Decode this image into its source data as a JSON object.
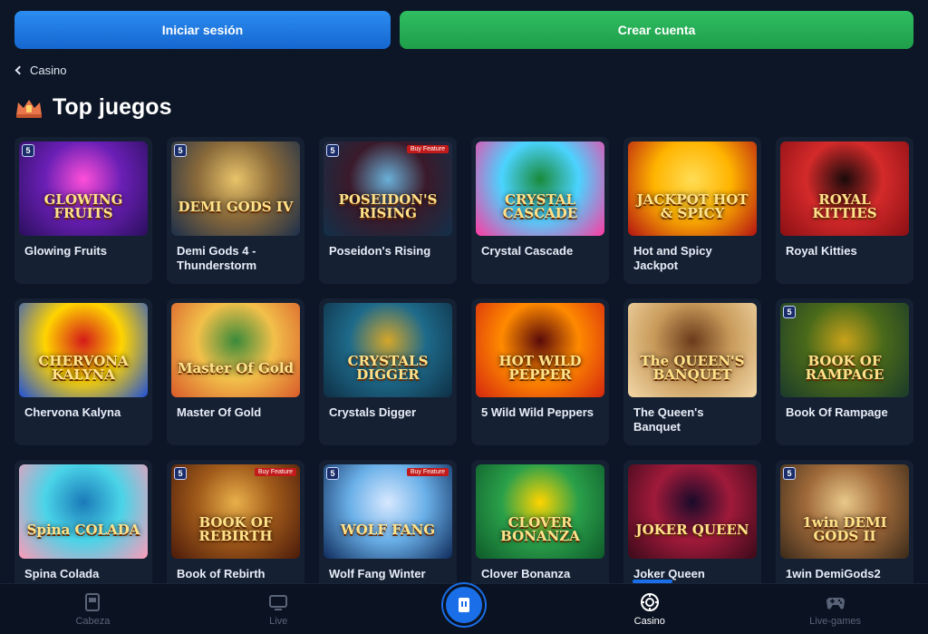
{
  "auth": {
    "login_label": "Iniciar sesión",
    "signup_label": "Crear cuenta"
  },
  "breadcrumb": {
    "label": "Casino"
  },
  "section": {
    "title": "Top juegos"
  },
  "games": [
    {
      "name": "Glowing Fruits",
      "art": "GLOWING FRUITS",
      "provider": "5",
      "tag": ""
    },
    {
      "name": "Demi Gods 4 - Thunderstorm",
      "art": "DEMI GODS IV",
      "provider": "5",
      "tag": ""
    },
    {
      "name": "Poseidon's Rising",
      "art": "POSEIDON'S RISING",
      "provider": "5",
      "tag": "Buy Feature"
    },
    {
      "name": "Crystal Cascade",
      "art": "CRYSTAL CASCADE",
      "provider": "",
      "tag": ""
    },
    {
      "name": "Hot and Spicy Jackpot",
      "art": "JACKPOT HOT & SPICY",
      "provider": "",
      "tag": ""
    },
    {
      "name": "Royal Kitties",
      "art": "ROYAL KITTIES",
      "provider": "",
      "tag": ""
    },
    {
      "name": "Chervona Kalyna",
      "art": "CHERVONA KALYNA",
      "provider": "",
      "tag": ""
    },
    {
      "name": "Master Of Gold",
      "art": "Master Of Gold",
      "provider": "",
      "tag": ""
    },
    {
      "name": "Crystals Digger",
      "art": "CRYSTALS DIGGER",
      "provider": "",
      "tag": ""
    },
    {
      "name": "5 Wild Wild Peppers",
      "art": "HOT WILD PEPPER",
      "provider": "",
      "tag": ""
    },
    {
      "name": "The Queen's Banquet",
      "art": "The QUEEN'S BANQUET",
      "provider": "",
      "tag": ""
    },
    {
      "name": "Book Of Rampage",
      "art": "BOOK OF RAMPAGE",
      "provider": "5",
      "tag": ""
    },
    {
      "name": "Spina Colada",
      "art": "Spina COLADA",
      "provider": "",
      "tag": ""
    },
    {
      "name": "Book of Rebirth",
      "art": "BOOK OF REBIRTH",
      "provider": "5",
      "tag": "Buy Feature"
    },
    {
      "name": "Wolf Fang Winter",
      "art": "WOLF FANG",
      "provider": "5",
      "tag": "Buy Feature"
    },
    {
      "name": "Clover Bonanza",
      "art": "CLOVER BONANZA",
      "provider": "",
      "tag": ""
    },
    {
      "name": "Joker Queen",
      "art": "JOKER QUEEN",
      "provider": "",
      "tag": ""
    },
    {
      "name": "1win DemiGods2",
      "art": "1win DEMI GODS II",
      "provider": "5",
      "tag": ""
    }
  ],
  "art_colors": [
    [
      "#2a0f5c",
      "#6a1fb5",
      "#ff4fd8"
    ],
    [
      "#1b2e4a",
      "#8a6a3a",
      "#e8c46a"
    ],
    [
      "#12304a",
      "#3a1a2a",
      "#6ab0d8"
    ],
    [
      "#ff3aa0",
      "#4bd3ff",
      "#1a8a3a"
    ],
    [
      "#b31212",
      "#ffb400",
      "#ffdd55"
    ],
    [
      "#8a0f14",
      "#d42a2a",
      "#1a0a0a"
    ],
    [
      "#1e4fd8",
      "#ffd400",
      "#d41a1a"
    ],
    [
      "#d85a2a",
      "#f2c04a",
      "#3a8a3a"
    ],
    [
      "#0e2f45",
      "#1e6a8a",
      "#d4a62a"
    ],
    [
      "#d4260e",
      "#ff8a00",
      "#5a0a0a"
    ],
    [
      "#f2d8a8",
      "#c89a5a",
      "#6a3a1a"
    ],
    [
      "#1a3a2a",
      "#4a6a1a",
      "#c8a21a"
    ],
    [
      "#ff9ab8",
      "#4ad4e8",
      "#1a7ab8"
    ],
    [
      "#4a1a0a",
      "#a05a1a",
      "#e8b04a"
    ],
    [
      "#0e2a5a",
      "#6ab0e8",
      "#d8e8ff"
    ],
    [
      "#0e5a2a",
      "#2aa04a",
      "#ffd400"
    ],
    [
      "#3a0a1a",
      "#a01a3a",
      "#1a0a2a"
    ],
    [
      "#3a2a1a",
      "#a06a3a",
      "#e8c88a"
    ]
  ],
  "nav": {
    "items": [
      {
        "label": "Cabeza",
        "icon": "home-icon"
      },
      {
        "label": "Live",
        "icon": "tv-icon"
      },
      {
        "label": "Casino",
        "icon": "casino-chip-icon"
      },
      {
        "label": "Live-games",
        "icon": "gamepad-icon"
      }
    ],
    "active_color": "#1a6fe8"
  }
}
